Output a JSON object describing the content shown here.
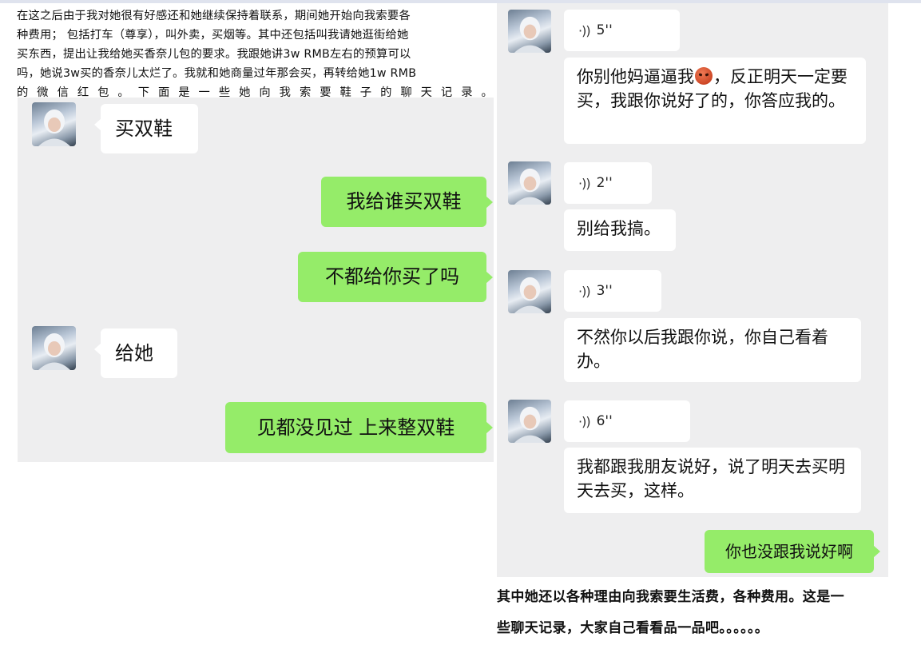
{
  "intro": {
    "lines": [
      "在这之后由于我对她很有好感还和她继续保持着联系，期间她开始向我索要各",
      "种费用；  包括打车（尊享），叫外卖，买烟等。其中还包括叫我请她逛街给她",
      "买东西，提出让我给她买香奈儿包的要求。我跟她讲3w    RMB左右的预算可以",
      "吗，她说3w买的香奈儿太烂了。我就和她商量过年那会买，再转给她1w   RMB",
      "的微信红包。下面是一些她向我索要鞋子的聊天记录。"
    ]
  },
  "left_chat": {
    "messages": [
      {
        "side": "left",
        "text": "买双鞋"
      },
      {
        "side": "right",
        "text": "我给谁买双鞋"
      },
      {
        "side": "right",
        "text": "不都给你买了吗"
      },
      {
        "side": "left",
        "text": "给她"
      },
      {
        "side": "right",
        "text": "见都没见过 上来整双鞋"
      }
    ]
  },
  "right_chat": {
    "voices": [
      {
        "duration": "5''"
      },
      {
        "duration": "2''"
      },
      {
        "duration": "3''"
      },
      {
        "duration": "6''"
      }
    ],
    "texts": [
      {
        "before_emoji": "你别他妈逼逼我",
        "after_emoji": "，反正明天一定要买，我跟你说好了的，你答应我的。"
      },
      {
        "text": "别给我搞。"
      },
      {
        "text": "不然你以后我跟你说，你自己看着办。"
      },
      {
        "text": "我都跟我朋友说好，说了明天去买明天去买，这样。"
      }
    ],
    "outgoing": "你也没跟我说好啊"
  },
  "bottom": {
    "line1": "其中她还以各种理由向我索要生活费，各种费用。这是一",
    "line2": "些聊天记录，大家自己看看品一品吧。。。。。。"
  },
  "icons": {
    "voice": "voice-wave-icon",
    "emoji": "angry-face-emoji"
  },
  "colors": {
    "chat_bg": "#eeeeef",
    "bubble_white": "#ffffff",
    "bubble_green": "#95ec69"
  }
}
